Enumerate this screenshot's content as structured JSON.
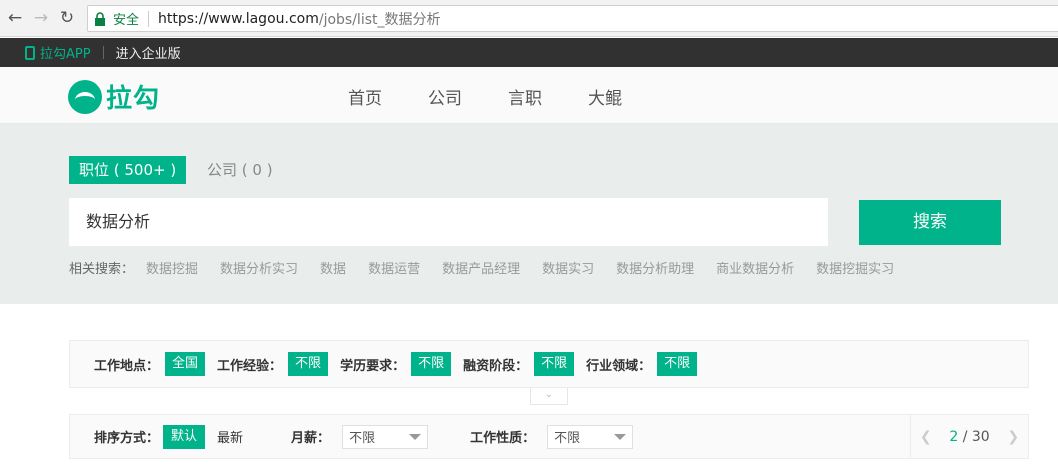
{
  "browser": {
    "secure_label": "安全",
    "url_host": "https://www.lagou.com",
    "url_path": "/jobs/list_数据分析"
  },
  "topbar": {
    "app_label": "拉勾APP",
    "enterprise_label": "进入企业版"
  },
  "header": {
    "logo_text": "拉勾",
    "nav": [
      "首页",
      "公司",
      "言职",
      "大鲲"
    ]
  },
  "search": {
    "tab_jobs": "职位 ( 500+ )",
    "tab_companies": "公司 ( 0 )",
    "query": "数据分析",
    "button_label": "搜索",
    "related_label": "相关搜索：",
    "related": [
      "数据挖掘",
      "数据分析实习",
      "数据",
      "数据运营",
      "数据产品经理",
      "数据实习",
      "数据分析助理",
      "商业数据分析",
      "数据挖掘实习"
    ]
  },
  "filters": [
    {
      "label": "工作地点：",
      "value": "全国"
    },
    {
      "label": "工作经验：",
      "value": "不限"
    },
    {
      "label": "学历要求：",
      "value": "不限"
    },
    {
      "label": "融资阶段：",
      "value": "不限"
    },
    {
      "label": "行业领域：",
      "value": "不限"
    }
  ],
  "sort": {
    "label": "排序方式：",
    "default": "默认",
    "newest": "最新",
    "salary_label": "月薪：",
    "salary_value": "不限",
    "nature_label": "工作性质：",
    "nature_value": "不限"
  },
  "pager": {
    "current": "2",
    "total": "/ 30"
  },
  "colors": {
    "brand": "#00b38a",
    "topbar": "#313131"
  }
}
